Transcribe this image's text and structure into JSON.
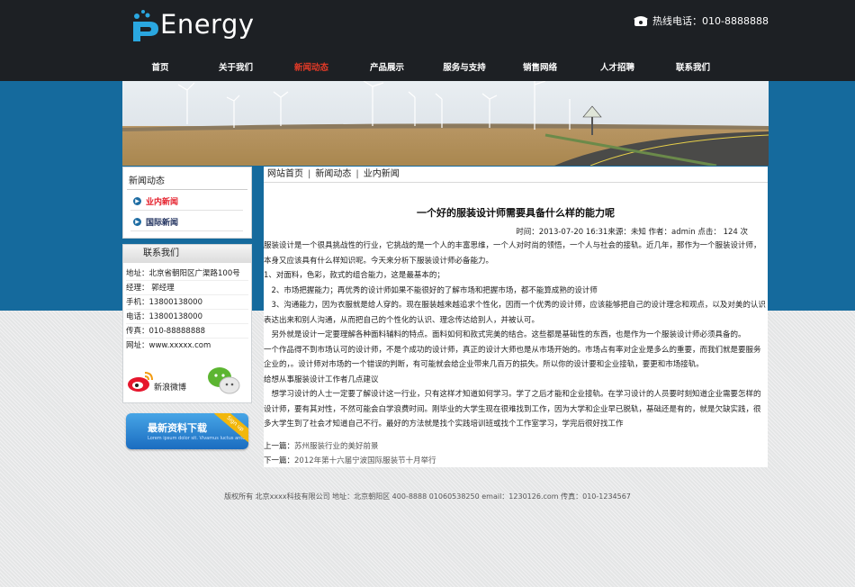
{
  "brand": {
    "logo_text": "Energy"
  },
  "hotline": {
    "label": "热线电话：010-8888888"
  },
  "nav": [
    {
      "label": "首页",
      "active": false
    },
    {
      "label": "关于我们",
      "active": false
    },
    {
      "label": "新闻动态",
      "active": true
    },
    {
      "label": "产品展示",
      "active": false
    },
    {
      "label": "服务与支持",
      "active": false
    },
    {
      "label": "销售网络",
      "active": false
    },
    {
      "label": "人才招聘",
      "active": false
    },
    {
      "label": "联系我们",
      "active": false
    }
  ],
  "sidebar": {
    "news_title": "新闻动态",
    "items": [
      {
        "label": "业内新闻",
        "current": true
      },
      {
        "label": "国际新闻",
        "current": false
      }
    ]
  },
  "contact": {
    "title": "联系我们",
    "lines": [
      "地址：北京省朝阳区广渠路100号",
      "经理： 郭经理",
      "手机：13800138000",
      "电话：13800138000",
      "传真：010-88888888",
      "网址：www.xxxxx.com"
    ],
    "weibo_label": "新浪微博"
  },
  "download": {
    "label": "最新资料下载",
    "sub": "Lorem ipsum dolor sit. Vivamus luctus ante",
    "ribbon": "Sign up"
  },
  "breadcrumb": [
    "网站首页",
    "新闻动态",
    "业内新闻"
  ],
  "article": {
    "title": "一个好的服装设计师需要具备什么样的能力呢",
    "meta": "时间：2013-07-20 16:31来源：未知 作者：admin 点击： 124 次",
    "paragraphs": [
      "服装设计是一个很具挑战性的行业，它挑战的是一个人的丰富思维，一个人对时尚的领悟，一个人与社会的接轨。近几年，那作为一个服装设计师，本身又应该具有什么样知识呢。今天来分析下服装设计师必备能力。",
      "1、对面料，色彩，款式的组合能力，这是最基本的；",
      "　2、市场把握能力；再优秀的设计师如果不能很好的了解市场和把握市场，都不能算成熟的设计师",
      "　3、沟通能力，因为衣服就是给人穿的。现在服装越来越追求个性化，因而一个优秀的设计师，应该能够把自己的设计理念和观点，以及对美的认识表达出来和别人沟通，从而把自己的个性化的认识、理念传达给别人，并被认可。",
      "　另外就是设计一定要理解各种面料辅料的特点。面料如何和款式完美的结合。这些都是基础性的东西，也是作为一个服装设计师必须具备的。",
      "一个作品得不到市场认可的设计师，不是个成功的设计师，真正的设计大师也是从市场开始的。市场占有率对企业是多么的重要，而我们就是要服务企业的，。设计师对市场的一个错误的判断，有可能就会给企业带来几百万的损失。所以你的设计要和企业接轨，要更和市场接轨。",
      "给想从事服装设计工作者几点建议",
      "　想学习设计的人士一定要了解设计这一行业，只有这样才知道如何学习。学了之后才能和企业接轨。在学习设计的人员要时刻知道企业需要怎样的设计师，要有其对性，不然可能会白学浪费时间。刚毕业的大学生现在很难找到工作，因为大学和企业早已脱轨，基础还是有的，就是欠缺实践，很多大学生到了社会才知道自己不行。最好的方法就是找个实践培训班或找个工作室学习，学完后很好找工作"
    ],
    "prev_label": "上一篇：",
    "prev_link": "苏州服装行业的美好前景",
    "next_label": "下一篇：",
    "next_link": "2012年第十六届宁波国际服装节十月举行"
  },
  "footer": "版权所有 北京xxxx科技有限公司 地址：北京朝阳区 400-8888 01060538250 email：1230126.com 传真：010-1234567"
}
